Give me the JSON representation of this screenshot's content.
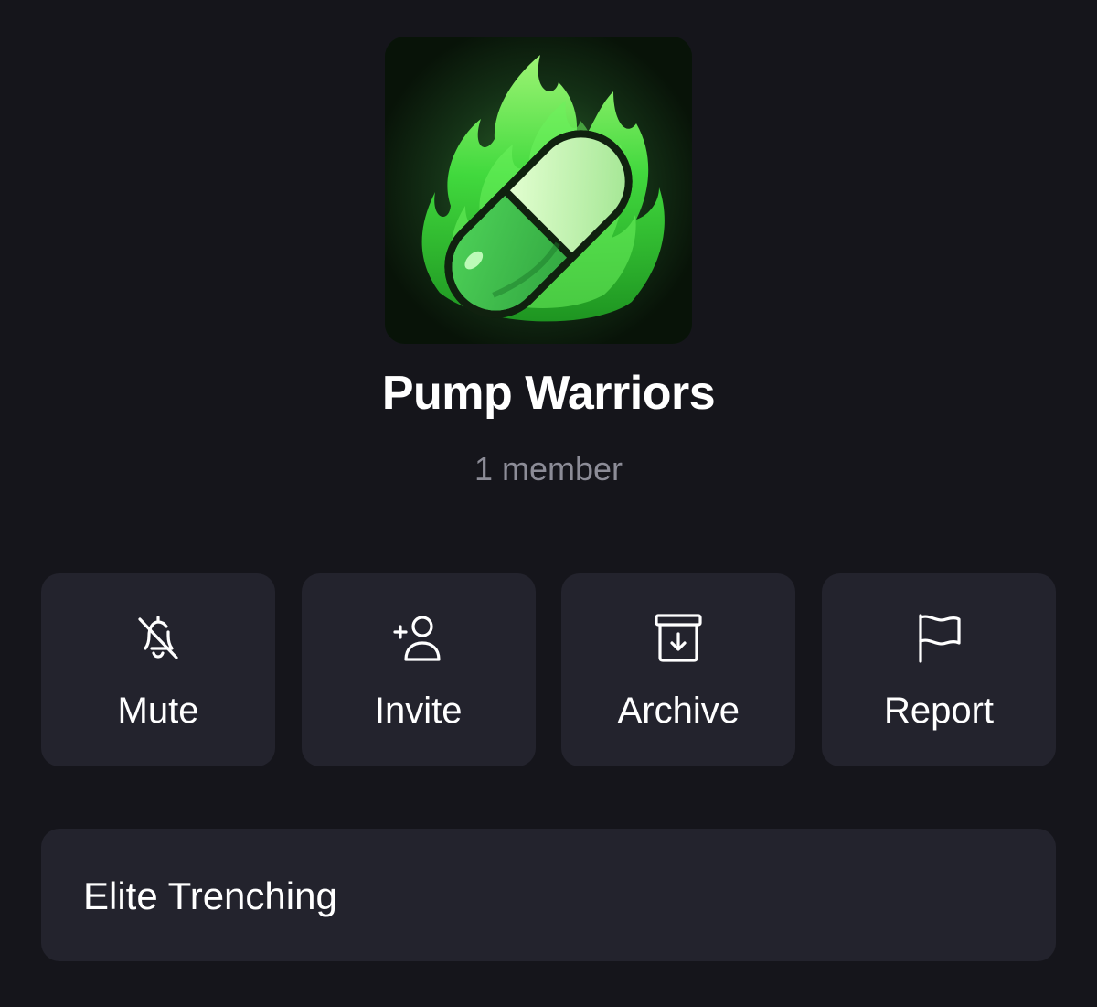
{
  "group": {
    "name": "Pump Warriors",
    "members": "1 member",
    "description": "Elite Trenching"
  },
  "actions": [
    {
      "label": "Mute",
      "icon": "bell-off-icon"
    },
    {
      "label": "Invite",
      "icon": "add-user-icon"
    },
    {
      "label": "Archive",
      "icon": "archive-box-icon"
    },
    {
      "label": "Report",
      "icon": "flag-icon"
    }
  ],
  "colors": {
    "background": "#15151b",
    "card": "#23232d",
    "text": "#ffffff",
    "muted": "#8c8c97",
    "accent_green": "#3fd84a"
  }
}
